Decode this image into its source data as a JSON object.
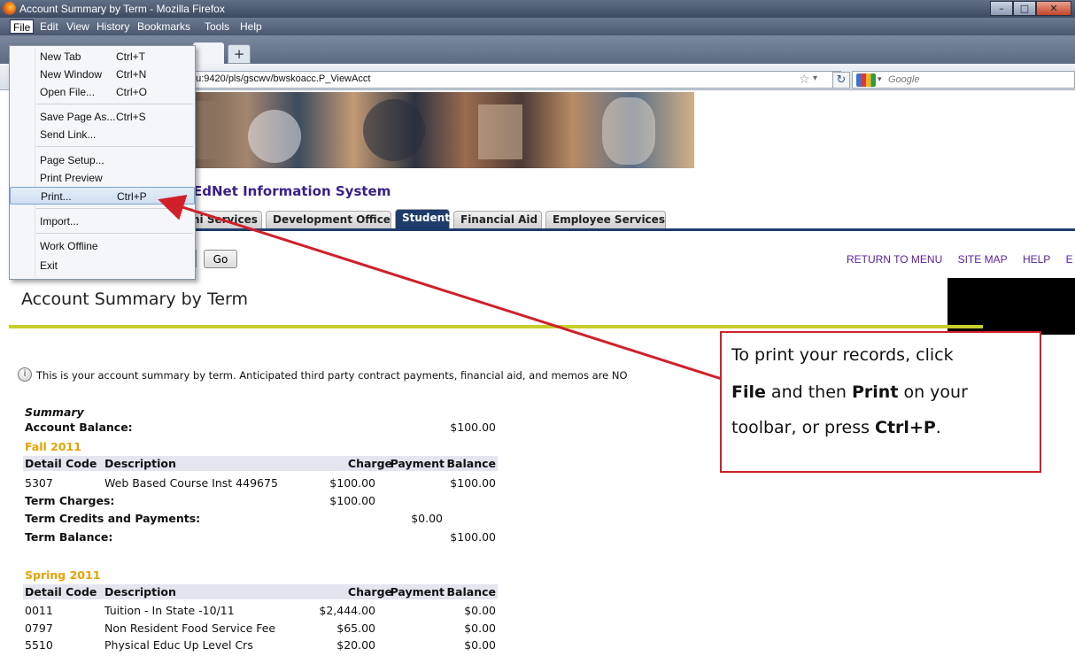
{
  "window": {
    "title": "Account Summary by Term - Mozilla Firefox"
  },
  "menubar": {
    "file": "File",
    "edit": "Edit",
    "view": "View",
    "history": "History",
    "bookmarks": "Bookmarks",
    "tools": "Tools",
    "help": "Help"
  },
  "newtab_label": "+",
  "address": {
    "url": "du:9420/pls/gscwv/bwskoacc.P_ViewAcct",
    "search_placeholder": "Google"
  },
  "file_menu": {
    "items": [
      {
        "label": "New Tab",
        "shortcut": "Ctrl+T"
      },
      {
        "label": "New Window",
        "shortcut": "Ctrl+N"
      },
      {
        "label": "Open File...",
        "shortcut": "Ctrl+O"
      },
      {
        "label": "Save Page As...",
        "shortcut": "Ctrl+S"
      },
      {
        "label": "Send Link...",
        "shortcut": ""
      },
      {
        "label": "Page Setup...",
        "shortcut": ""
      },
      {
        "label": "Print Preview",
        "shortcut": ""
      },
      {
        "label": "Print...",
        "shortcut": "Ctrl+P"
      },
      {
        "label": "Import...",
        "shortcut": ""
      },
      {
        "label": "Work Offline",
        "shortcut": ""
      },
      {
        "label": "Exit",
        "shortcut": ""
      }
    ]
  },
  "site": {
    "title": "EdNet Information System",
    "tabs": [
      "ni Services",
      "Development Office",
      "Student",
      "Financial Aid",
      "Employee Services"
    ],
    "go_button": "Go",
    "links": [
      "RETURN TO MENU",
      "SITE MAP",
      "HELP",
      "E"
    ]
  },
  "page": {
    "title": "Account Summary by Term",
    "info": "This is your account summary by term. Anticipated third party contract payments, financial aid, and memos are NO"
  },
  "summary": {
    "heading": "Summary",
    "account_balance_label": "Account Balance:",
    "account_balance": "$100.00",
    "headers": {
      "code": "Detail Code",
      "desc": "Description",
      "charge": "Charge",
      "payment": "Payment",
      "balance": "Balance"
    },
    "term_charges_label": "Term Charges:",
    "term_credits_label": "Term Credits and Payments:",
    "term_balance_label": "Term Balance:",
    "terms": [
      {
        "name": "Fall 2011",
        "rows": [
          {
            "code": "5307",
            "desc": "Web Based Course Inst 449675",
            "charge": "$100.00",
            "payment": "",
            "balance": "$100.00"
          }
        ],
        "term_charges": "$100.00",
        "term_credits": "$0.00",
        "term_balance": "$100.00"
      },
      {
        "name": "Spring 2011",
        "rows": [
          {
            "code": "0011",
            "desc": "Tuition - In State -10/11",
            "charge": "$2,444.00",
            "payment": "",
            "balance": "$0.00"
          },
          {
            "code": "0797",
            "desc": "Non Resident Food Service Fee",
            "charge": "$65.00",
            "payment": "",
            "balance": "$0.00"
          },
          {
            "code": "5510",
            "desc": "Physical Educ Up Level Crs",
            "charge": "$20.00",
            "payment": "",
            "balance": "$0.00"
          }
        ]
      }
    ]
  },
  "callout": {
    "line1": "To print your records, click",
    "file": "File",
    "and_then": " and then ",
    "print": "Print",
    "on_your": " on your",
    "line3_pre": "toolbar, or press ",
    "ctrlp": "Ctrl+P",
    "period": ".",
    "border_color": "#d0202a"
  }
}
